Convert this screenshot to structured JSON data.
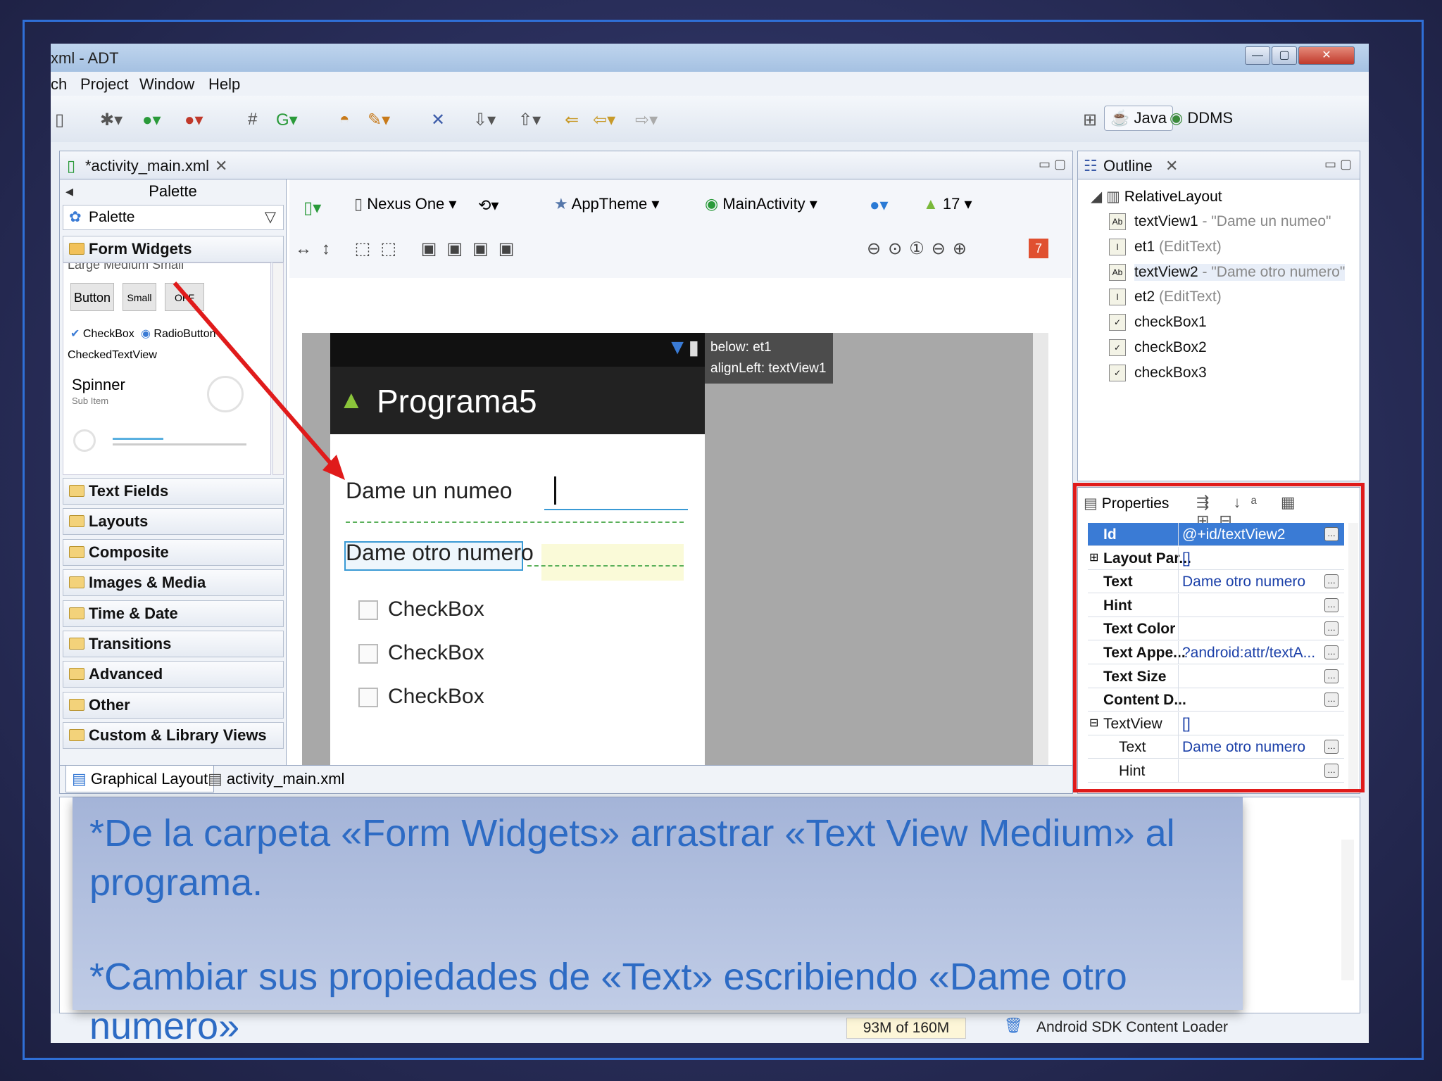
{
  "window": {
    "title": "xml - ADT"
  },
  "menu": [
    "ch",
    "Project",
    "Window",
    "Help"
  ],
  "perspectives": {
    "java": "Java",
    "ddms": "DDMS"
  },
  "editor_tab": {
    "label": "*activity_main.xml"
  },
  "palette": {
    "header": "Palette",
    "dropdown": "Palette",
    "form_widgets": "Form Widgets",
    "widget_sizes": "Large Medium Small",
    "buttons": [
      "Button",
      "Small",
      "OFF"
    ],
    "checkbox": "CheckBox",
    "radiobutton": "RadioButton",
    "checkedtextview": "CheckedTextView",
    "spinner": "Spinner",
    "spinner_sub": "Sub Item",
    "categories": [
      "Text Fields",
      "Layouts",
      "Composite",
      "Images & Media",
      "Time & Date",
      "Transitions",
      "Advanced",
      "Other",
      "Custom & Library Views"
    ]
  },
  "layout_toolbar": {
    "device": "Nexus One",
    "theme": "AppTheme",
    "activity": "MainActivity",
    "api": "17",
    "error_count": "7"
  },
  "device_preview": {
    "app_title": "Programa5",
    "text1": "Dame un numeo",
    "text2": "Dame otro numero",
    "checkboxes": [
      "CheckBox",
      "CheckBox",
      "CheckBox"
    ],
    "tooltip_line1": "below: et1",
    "tooltip_line2": "alignLeft: textView1"
  },
  "bottom_tabs": {
    "graphical": "Graphical Layout",
    "xml": "activity_main.xml"
  },
  "outline": {
    "title": "Outline",
    "root": "RelativeLayout",
    "items": [
      {
        "name": "textView1",
        "detail": " - \"Dame un numeo\""
      },
      {
        "name": "et1",
        "detail": " (EditText)"
      },
      {
        "name": "textView2",
        "detail": " - \"Dame otro numero\""
      },
      {
        "name": "et2",
        "detail": " (EditText)"
      },
      {
        "name": "checkBox1",
        "detail": ""
      },
      {
        "name": "checkBox2",
        "detail": ""
      },
      {
        "name": "checkBox3",
        "detail": ""
      }
    ]
  },
  "properties": {
    "title": "Properties",
    "rows": [
      {
        "key": "Id",
        "value": "@+id/textView2"
      },
      {
        "key": "Layout Par...",
        "value": "[]"
      },
      {
        "key": "Text",
        "value": "Dame otro numero"
      },
      {
        "key": "Hint",
        "value": ""
      },
      {
        "key": "Text Color",
        "value": ""
      },
      {
        "key": "Text Appe...",
        "value": "?android:attr/textA..."
      },
      {
        "key": "Text Size",
        "value": ""
      },
      {
        "key": "Content D...",
        "value": ""
      },
      {
        "key": "TextView",
        "value": "[]"
      },
      {
        "key": "Text",
        "value": "Dame otro numero"
      },
      {
        "key": "Hint",
        "value": ""
      }
    ]
  },
  "status": {
    "memory": "93M of 160M",
    "loader": "Android SDK Content Loader"
  },
  "callout": {
    "line1": "*De la carpeta «Form Widgets» arrastrar «Text View Medium» al programa.",
    "line2": "*Cambiar sus propiedades de «Text» escribiendo «Dame otro numero»"
  },
  "colors": {
    "highlight_red": "#e01b1b",
    "callout_text": "#2d6bc4",
    "selection_blue": "#3a7bd5"
  }
}
